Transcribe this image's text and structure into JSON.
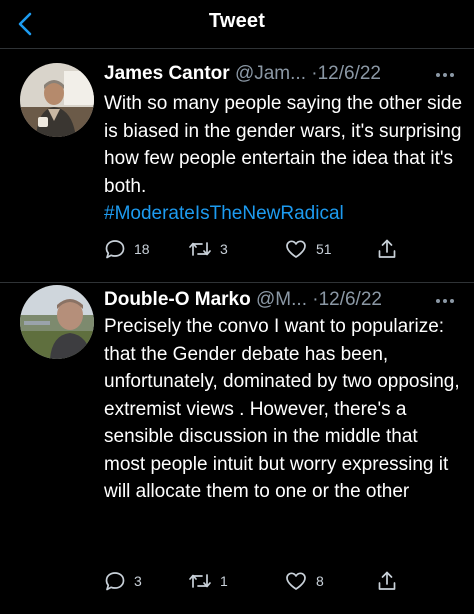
{
  "header": {
    "title": "Tweet",
    "back_icon": "chevron-left-icon"
  },
  "colors": {
    "background": "#000000",
    "accent": "#1d9bf0",
    "secondary_text": "#8b98a5",
    "divider": "#2f3336"
  },
  "tweets": [
    {
      "name": "James Cantor",
      "handle": "@Jam...",
      "separator": "·",
      "date": "12/6/22",
      "more_icon": "ellipsis-icon",
      "text": "With so many people saying the other side is biased in the gender wars, it's surprising how few people entertain the idea that it's both.",
      "hashtag": "#ModerateIsTheNewRadical",
      "replies": "18",
      "retweets": "3",
      "likes": "51"
    },
    {
      "name": "Double-O Marko",
      "handle": "@M...",
      "separator": "·",
      "date": "12/6/22",
      "more_icon": "ellipsis-icon",
      "text": "Precisely the convo I want to popularize: that the Gender debate has been, unfortunately, dominated by two opposing, extremist views . However, there's a sensible discussion in the middle that most people intuit but worry expressing it will allocate them to one or the other",
      "replies": "3",
      "retweets": "1",
      "likes": "8"
    }
  ],
  "action_icons": [
    "reply-icon",
    "retweet-icon",
    "like-icon",
    "share-icon"
  ]
}
